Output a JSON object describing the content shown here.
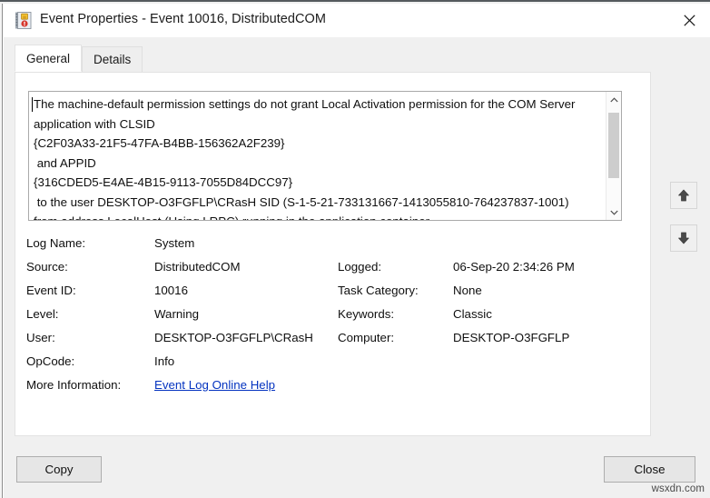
{
  "window": {
    "title": "Event Properties - Event 10016, DistributedCOM",
    "icon": "event-log-book-icon",
    "close_label": "✕"
  },
  "tabs": [
    {
      "label": "General",
      "active": true
    },
    {
      "label": "Details",
      "active": false
    }
  ],
  "description": {
    "text": "The machine-default permission settings do not grant Local Activation permission for the COM Server application with CLSID\n{C2F03A33-21F5-47FA-B4BB-156362A2F239}\n and APPID\n{316CDED5-E4AE-4B15-9113-7055D84DCC97}\n to the user DESKTOP-O3FGFLP\\CRasH SID (S-1-5-21-733131667-1413055810-764237837-1001) from address LocalHost (Using LRPC) running in the application container"
  },
  "fields_left": [
    {
      "label": "Log Name:",
      "value": "System"
    },
    {
      "label": "Source:",
      "value": "DistributedCOM"
    },
    {
      "label": "Event ID:",
      "value": "10016"
    },
    {
      "label": "Level:",
      "value": "Warning"
    },
    {
      "label": "User:",
      "value": "DESKTOP-O3FGFLP\\CRasH"
    },
    {
      "label": "OpCode:",
      "value": "Info"
    },
    {
      "label": "More Information:",
      "value": "Event Log Online Help"
    }
  ],
  "fields_right": [
    {
      "label": "Logged:",
      "value": "06-Sep-20 2:34:26 PM"
    },
    {
      "label": "Task Category:",
      "value": "None"
    },
    {
      "label": "Keywords:",
      "value": "Classic"
    },
    {
      "label": "Computer:",
      "value": "DESKTOP-O3FGFLP"
    }
  ],
  "nav": {
    "up_label": "previous-event",
    "down_label": "next-event"
  },
  "buttons": {
    "copy": "Copy",
    "close": "Close"
  },
  "watermark": "wsxdn.com",
  "colors": {
    "dialog_bg": "#f0f0f0",
    "panel_bg": "#ffffff",
    "titlebar_bg": "#ffffff",
    "link": "#0433c0",
    "button_bg": "#e6e6e6",
    "scroll_thumb": "#cdcdcd"
  }
}
